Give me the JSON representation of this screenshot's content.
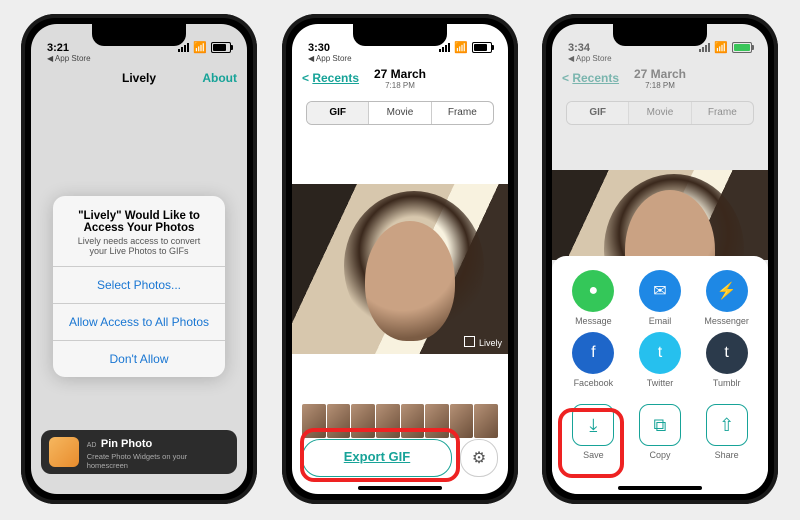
{
  "phone1": {
    "status": {
      "time": "3:21",
      "substatus": "◀ App Store"
    },
    "nav": {
      "title": "Lively",
      "about": "About"
    },
    "modal": {
      "title": "\"Lively\" Would Like to Access Your Photos",
      "body": "Lively needs access to convert your Live Photos to GIFs",
      "options": [
        "Select Photos...",
        "Allow Access to All Photos",
        "Don't Allow"
      ]
    },
    "ad": {
      "label": "AD",
      "title": "Pin Photo",
      "sub": "Create Photo Widgets on your homescreen"
    }
  },
  "phone2": {
    "status": {
      "time": "3:30",
      "substatus": "◀ App Store"
    },
    "nav": {
      "back": "Recents",
      "title": "27 March",
      "subtitle": "7:18 PM"
    },
    "segments": [
      "GIF",
      "Movie",
      "Frame"
    ],
    "watermark": "Lively",
    "export": "Export GIF"
  },
  "phone3": {
    "status": {
      "time": "3:34",
      "substatus": "◀ App Store"
    },
    "nav": {
      "back": "Recents",
      "title": "27 March",
      "subtitle": "7:18 PM"
    },
    "segments": [
      "GIF",
      "Movie",
      "Frame"
    ],
    "share": {
      "apps": [
        {
          "name": "Message",
          "bg": "#34c759",
          "glyph": "●"
        },
        {
          "name": "Email",
          "bg": "#1e88e5",
          "glyph": "✉"
        },
        {
          "name": "Messenger",
          "bg": "#1e88e5",
          "glyph": "⚡"
        },
        {
          "name": "Facebook",
          "bg": "#1e66c9",
          "glyph": "f"
        },
        {
          "name": "Twitter",
          "bg": "#26c0ee",
          "glyph": "t"
        },
        {
          "name": "Tumblr",
          "bg": "#2b3a4b",
          "glyph": "t"
        }
      ],
      "actions": [
        {
          "name": "Save",
          "glyph": "⤓"
        },
        {
          "name": "Copy",
          "glyph": "⧉"
        },
        {
          "name": "Share",
          "glyph": "⇧"
        }
      ]
    }
  }
}
